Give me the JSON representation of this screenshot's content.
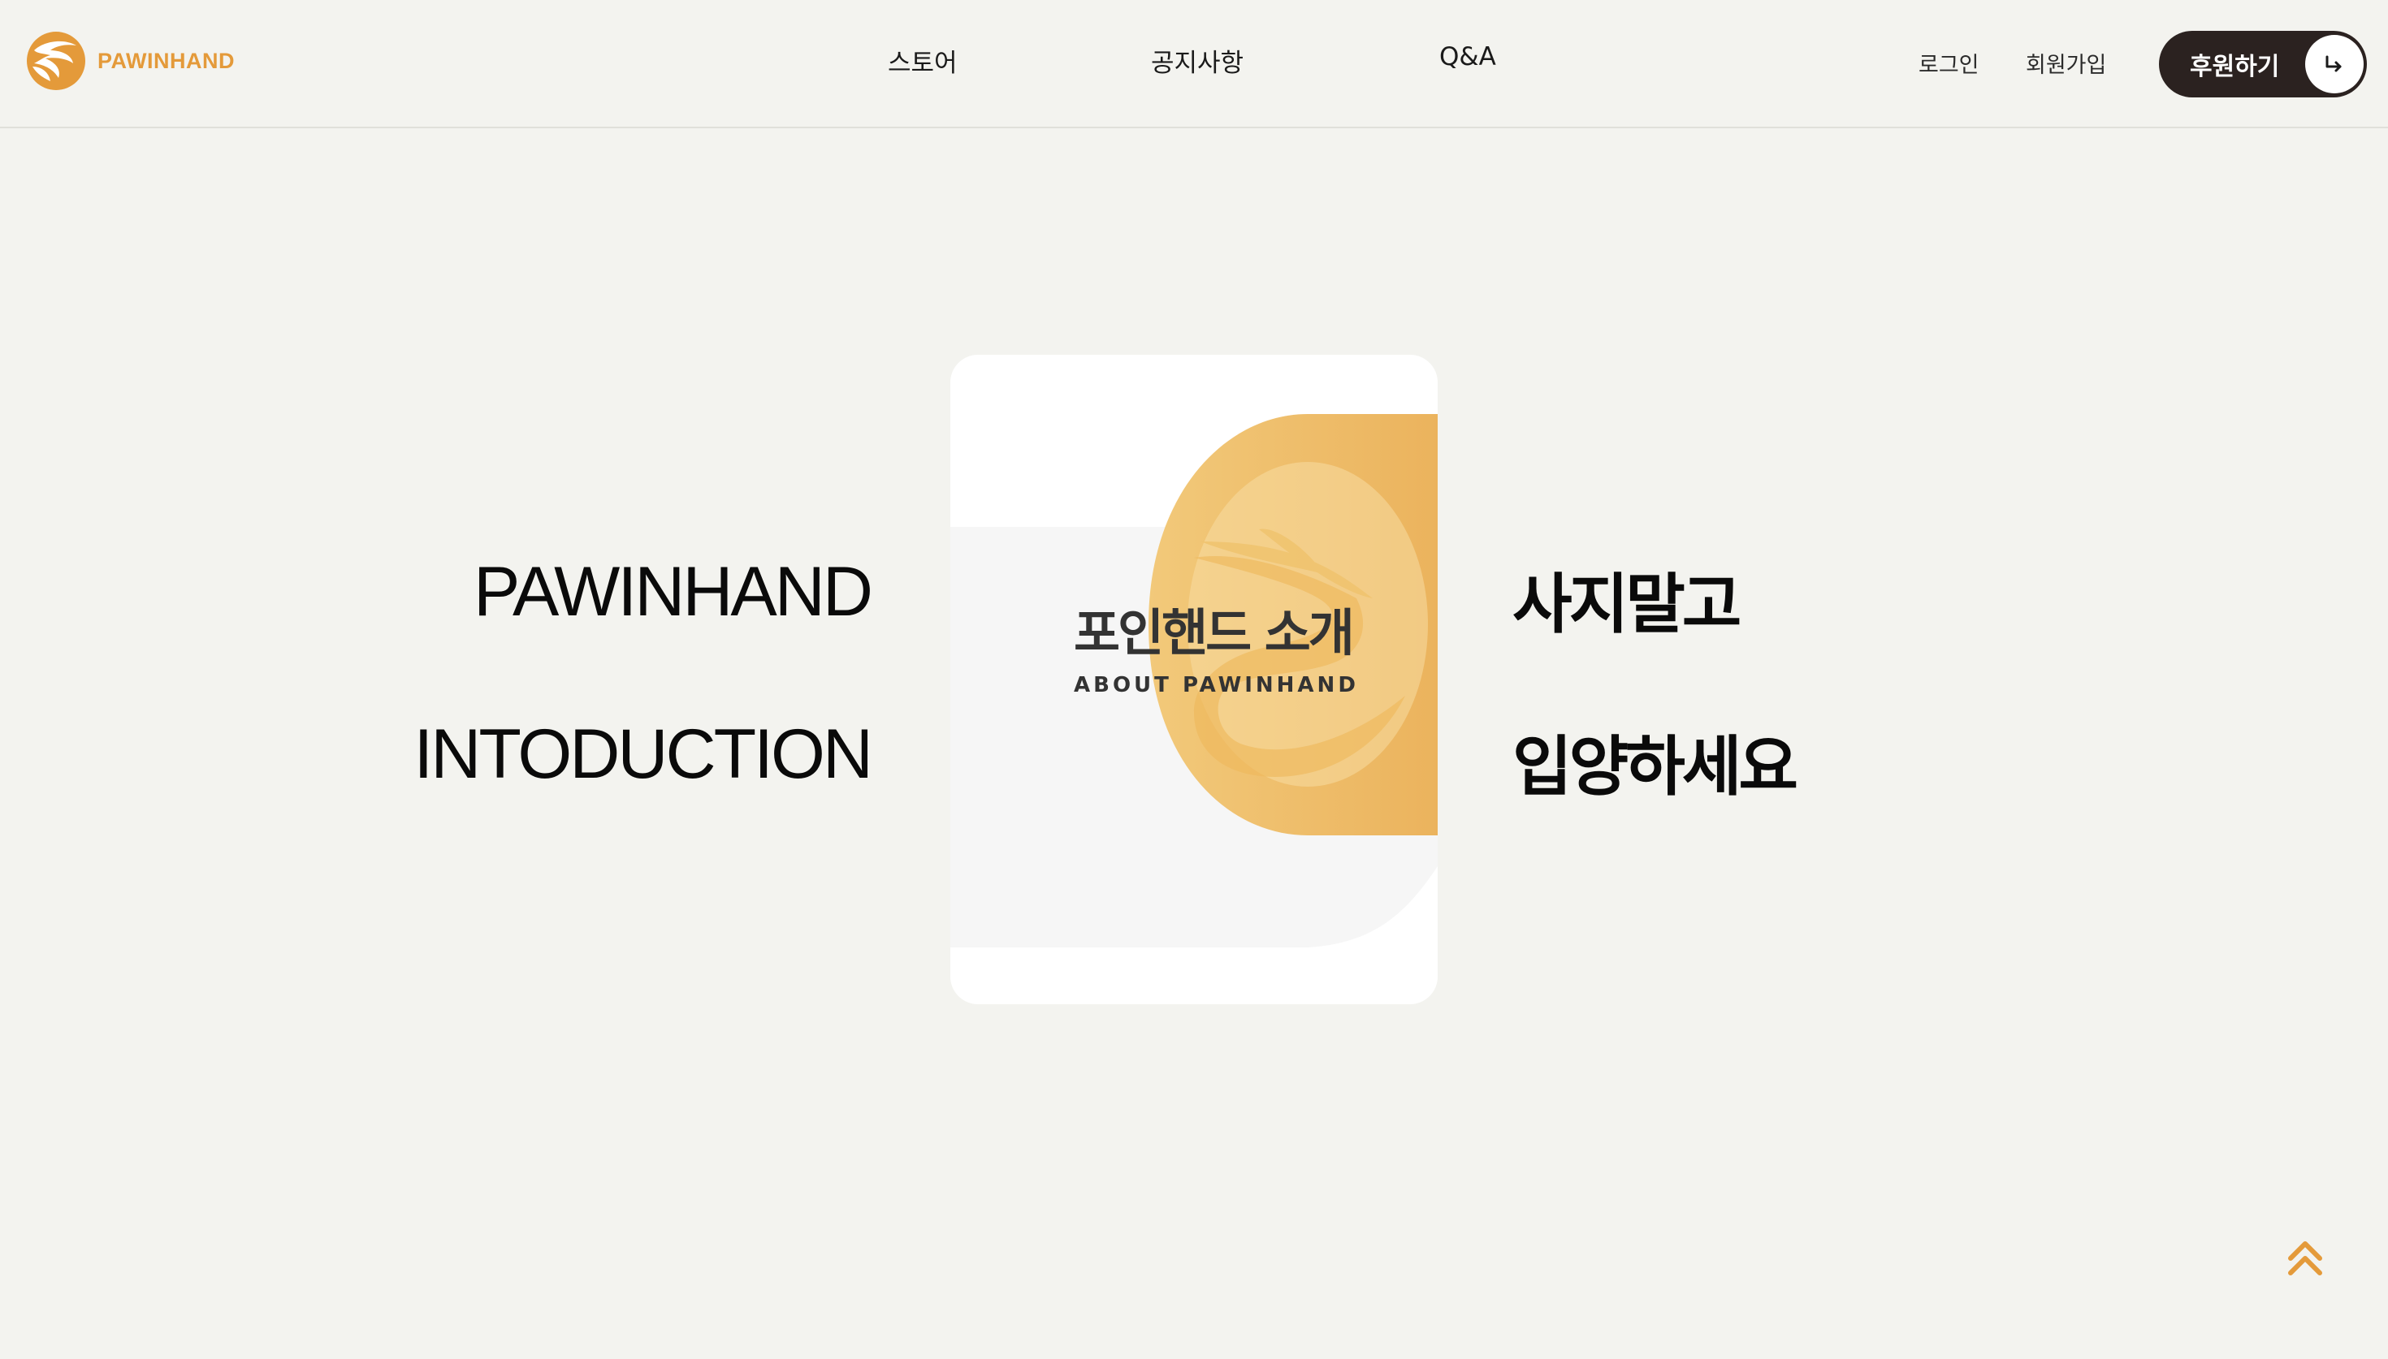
{
  "brand": {
    "name": "PAWINHAND",
    "logo_icon": "paw-in-hand-logo-icon",
    "accent_color": "#e49a3a"
  },
  "nav": {
    "items": [
      {
        "label": "스토어"
      },
      {
        "label": "공지사항"
      },
      {
        "label": "Q&A"
      }
    ]
  },
  "auth": {
    "login_label": "로그인",
    "signup_label": "회원가입"
  },
  "donate": {
    "label": "후원하기",
    "icon": "arrow-return-icon",
    "bg_color": "#2b2220"
  },
  "hero": {
    "left_lines": [
      "PAWINHAND",
      "INTODUCTION"
    ],
    "right_lines": [
      "사지말고",
      "입양하세요"
    ],
    "card": {
      "title": "포인핸드 소개",
      "subtitle": "ABOUT PAWINHAND",
      "gradient_start": "#f2c97a",
      "gradient_end": "#ebb35d"
    }
  },
  "scroll_top": {
    "icon": "double-chevron-up-icon",
    "color": "#e49a3a"
  }
}
